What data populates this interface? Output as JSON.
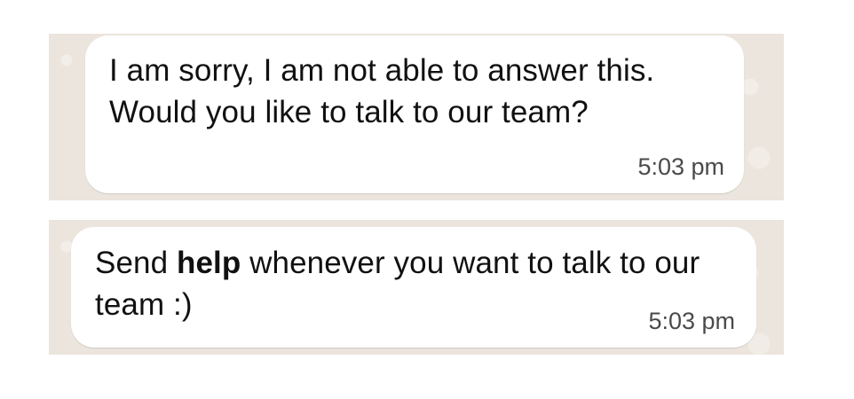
{
  "messages": [
    {
      "text": "I am sorry, I am not able to answer this. Would you like to talk to our team?",
      "time": "5:03 pm"
    },
    {
      "text_before": "Send ",
      "bold": "help",
      "text_after": " whenever you want to talk to our team :)",
      "time": "5:03 pm"
    }
  ],
  "colors": {
    "chat_background": "#ece5dd",
    "bubble": "#ffffff",
    "text": "#111111",
    "timestamp": "#4a4a4a"
  }
}
